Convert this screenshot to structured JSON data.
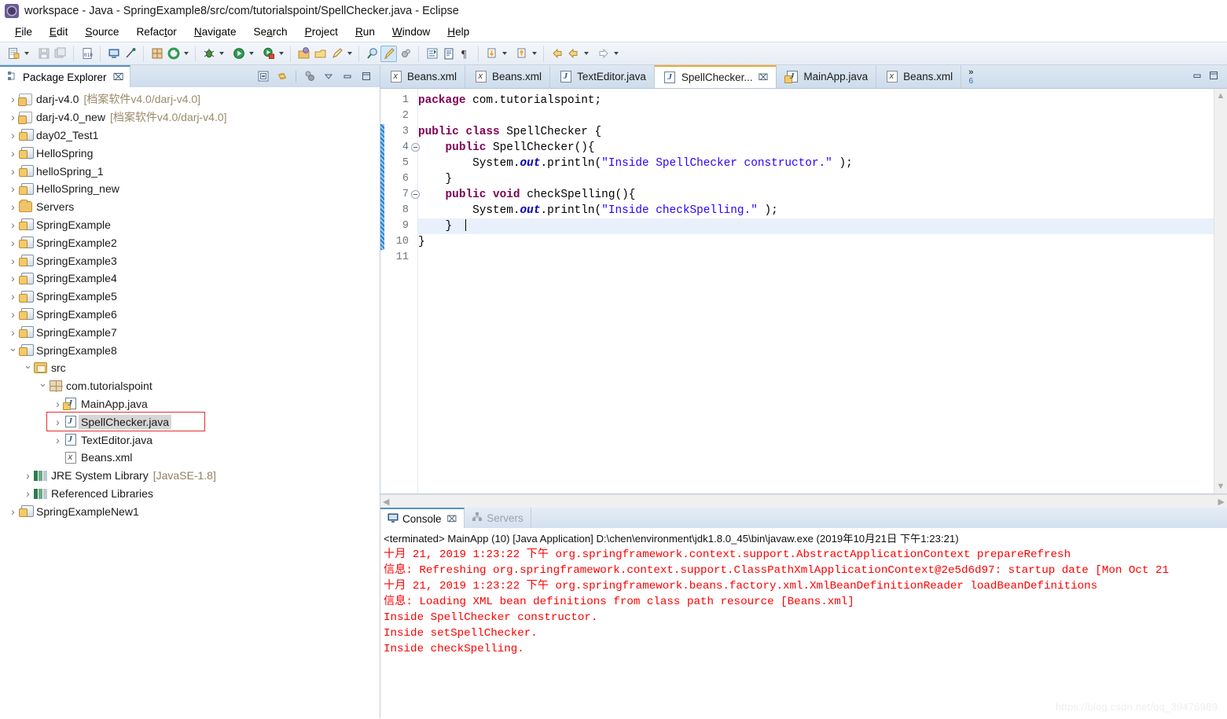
{
  "window": {
    "title": "workspace - Java - SpringExample8/src/com/tutorialspoint/SpellChecker.java - Eclipse",
    "app_icon": "eclipse-icon"
  },
  "menubar": [
    {
      "label": "File",
      "mnemonic": "F"
    },
    {
      "label": "Edit",
      "mnemonic": "E"
    },
    {
      "label": "Source",
      "mnemonic": "S"
    },
    {
      "label": "Refactor",
      "mnemonic": "t"
    },
    {
      "label": "Navigate",
      "mnemonic": "N"
    },
    {
      "label": "Search",
      "mnemonic": "a"
    },
    {
      "label": "Project",
      "mnemonic": "P"
    },
    {
      "label": "Run",
      "mnemonic": "R"
    },
    {
      "label": "Window",
      "mnemonic": "W"
    },
    {
      "label": "Help",
      "mnemonic": "H"
    }
  ],
  "toolbar": {
    "buttons": [
      "new-wizard-icon",
      "save-icon",
      "save-all-icon",
      "print-icon",
      "new-java-class-icon",
      "open-type-icon",
      "link-icon",
      "toggle-mark-occurrences-icon",
      "refresh-icon",
      "debug-icon",
      "run-icon",
      "run-external-tools-icon",
      "open-perspective-icon",
      "open-task-icon",
      "search-icon",
      "new-java-project-icon",
      "highlight-icon",
      "skip-breakpoints-icon",
      "next-annotation-icon",
      "previous-annotation-icon",
      "toggle-block-icon",
      "back-icon",
      "forward-icon"
    ]
  },
  "explorer": {
    "tab_label": "Package Explorer",
    "close_label": "⌧",
    "tools": [
      "collapse-all-icon",
      "link-with-editor-icon",
      "view-menu-icon",
      "minimize-icon",
      "maximize-icon"
    ],
    "tree": [
      {
        "label": "darj-v4.0",
        "note": "[档案软件v4.0/darj-v4.0]",
        "icon": "project-icon",
        "indent": 0,
        "twisty": "closed"
      },
      {
        "label": "darj-v4.0_new",
        "note": "[档案软件v4.0/darj-v4.0]",
        "icon": "project-icon",
        "indent": 0,
        "twisty": "closed"
      },
      {
        "label": "day02_Test1",
        "note": "",
        "icon": "java-project-icon",
        "indent": 0,
        "twisty": "closed"
      },
      {
        "label": "HelloSpring",
        "note": "",
        "icon": "java-project-icon",
        "indent": 0,
        "twisty": "closed"
      },
      {
        "label": "helloSpring_1",
        "note": "",
        "icon": "java-project-icon",
        "indent": 0,
        "twisty": "closed"
      },
      {
        "label": "HelloSpring_new",
        "note": "",
        "icon": "java-project-icon",
        "indent": 0,
        "twisty": "closed"
      },
      {
        "label": "Servers",
        "note": "",
        "icon": "folder-icon",
        "indent": 0,
        "twisty": "closed"
      },
      {
        "label": "SpringExample",
        "note": "",
        "icon": "java-project-icon",
        "indent": 0,
        "twisty": "closed"
      },
      {
        "label": "SpringExample2",
        "note": "",
        "icon": "java-project-icon",
        "indent": 0,
        "twisty": "closed"
      },
      {
        "label": "SpringExample3",
        "note": "",
        "icon": "java-project-icon",
        "indent": 0,
        "twisty": "closed"
      },
      {
        "label": "SpringExample4",
        "note": "",
        "icon": "java-project-icon",
        "indent": 0,
        "twisty": "closed"
      },
      {
        "label": "SpringExample5",
        "note": "",
        "icon": "java-project-icon",
        "indent": 0,
        "twisty": "closed"
      },
      {
        "label": "SpringExample6",
        "note": "",
        "icon": "java-project-icon",
        "indent": 0,
        "twisty": "closed"
      },
      {
        "label": "SpringExample7",
        "note": "",
        "icon": "java-project-icon",
        "indent": 0,
        "twisty": "closed"
      },
      {
        "label": "SpringExample8",
        "note": "",
        "icon": "java-project-icon",
        "indent": 0,
        "twisty": "open"
      },
      {
        "label": "src",
        "note": "",
        "icon": "source-folder-icon",
        "indent": 1,
        "twisty": "open"
      },
      {
        "label": "com.tutorialspoint",
        "note": "",
        "icon": "package-icon",
        "indent": 2,
        "twisty": "open"
      },
      {
        "label": "MainApp.java",
        "note": "",
        "icon": "java-file-warn-icon",
        "indent": 3,
        "twisty": "closed"
      },
      {
        "label": "SpellChecker.java",
        "note": "",
        "icon": "java-file-icon",
        "indent": 3,
        "twisty": "closed",
        "selected": true,
        "annotated": true
      },
      {
        "label": "TextEditor.java",
        "note": "",
        "icon": "java-file-icon",
        "indent": 3,
        "twisty": "closed"
      },
      {
        "label": "Beans.xml",
        "note": "",
        "icon": "xml-file-icon",
        "indent": 3,
        "twisty": "none"
      },
      {
        "label": "JRE System Library",
        "note": "[JavaSE-1.8]",
        "icon": "library-icon",
        "indent": 1,
        "twisty": "closed"
      },
      {
        "label": "Referenced Libraries",
        "note": "",
        "icon": "library-icon",
        "indent": 1,
        "twisty": "closed"
      },
      {
        "label": "SpringExampleNew1",
        "note": "",
        "icon": "java-project-icon",
        "indent": 0,
        "twisty": "closed"
      }
    ]
  },
  "editor": {
    "tabs": [
      {
        "label": "Beans.xml",
        "icon": "xml-file-icon",
        "selected": false
      },
      {
        "label": "Beans.xml",
        "icon": "xml-file-icon",
        "selected": false
      },
      {
        "label": "TextEditor.java",
        "icon": "java-file-icon",
        "selected": false
      },
      {
        "label": "SpellChecker...",
        "icon": "java-file-icon",
        "selected": true,
        "close": "⌧"
      },
      {
        "label": "MainApp.java",
        "icon": "java-file-warn-icon",
        "selected": false
      },
      {
        "label": "Beans.xml",
        "icon": "xml-file-icon",
        "selected": false
      }
    ],
    "overflow": {
      "symbol": "»",
      "count": "6"
    },
    "tools": [
      "restore-icon",
      "maximize-icon"
    ],
    "line_numbers": [
      "1",
      "2",
      "3",
      "4",
      "5",
      "6",
      "7",
      "8",
      "9",
      "10",
      "11"
    ],
    "fold_lines": [
      4,
      7
    ],
    "current_line": 9,
    "changed_range": {
      "from": 3,
      "to": 10
    },
    "code_lines": [
      [
        {
          "t": "package ",
          "c": "kw"
        },
        {
          "t": "com.tutorialspoint;",
          "c": ""
        }
      ],
      [],
      [
        {
          "t": "public class ",
          "c": "kw"
        },
        {
          "t": "SpellChecker {",
          "c": ""
        }
      ],
      [
        {
          "t": "    public ",
          "c": "kw"
        },
        {
          "t": "SpellChecker(){",
          "c": ""
        }
      ],
      [
        {
          "t": "        System.",
          "c": ""
        },
        {
          "t": "out",
          "c": "fld"
        },
        {
          "t": ".println(",
          "c": ""
        },
        {
          "t": "\"Inside SpellChecker constructor.\"",
          "c": "str"
        },
        {
          "t": " );",
          "c": ""
        }
      ],
      [
        {
          "t": "    }",
          "c": ""
        }
      ],
      [
        {
          "t": "    public void ",
          "c": "kw"
        },
        {
          "t": "checkSpelling(){",
          "c": ""
        }
      ],
      [
        {
          "t": "        System.",
          "c": ""
        },
        {
          "t": "out",
          "c": "fld"
        },
        {
          "t": ".println(",
          "c": ""
        },
        {
          "t": "\"Inside checkSpelling.\"",
          "c": "str"
        },
        {
          "t": " );",
          "c": ""
        }
      ],
      [
        {
          "t": "    }  ",
          "c": ""
        },
        {
          "t": "",
          "c": "caret"
        }
      ],
      [
        {
          "t": "}",
          "c": ""
        }
      ],
      []
    ]
  },
  "console": {
    "tabs": [
      {
        "label": "Console",
        "icon": "console-icon",
        "selected": true,
        "close": "⌧"
      },
      {
        "label": "Servers",
        "icon": "servers-icon",
        "selected": false
      }
    ],
    "header": "<terminated> MainApp (10) [Java Application] D:\\chen\\environment\\jdk1.8.0_45\\bin\\javaw.exe (2019年10月21日 下午1:23:21)",
    "lines": [
      {
        "text": "十月 21, 2019 1:23:22 下午 org.springframework.context.support.AbstractApplicationContext prepareRefresh",
        "kind": "err"
      },
      {
        "text": "信息: Refreshing org.springframework.context.support.ClassPathXmlApplicationContext@2e5d6d97: startup date [Mon Oct 21 ",
        "kind": "err"
      },
      {
        "text": "十月 21, 2019 1:23:22 下午 org.springframework.beans.factory.xml.XmlBeanDefinitionReader loadBeanDefinitions",
        "kind": "err"
      },
      {
        "text": "信息: Loading XML bean definitions from class path resource [Beans.xml]",
        "kind": "err"
      },
      {
        "text": "Inside SpellChecker constructor.",
        "kind": "out"
      },
      {
        "text": "Inside setSpellChecker.",
        "kind": "out"
      },
      {
        "text": "Inside checkSpelling.",
        "kind": "out"
      }
    ]
  },
  "watermark": "https://blog.csdn.net/qq_39476989",
  "colors": {
    "keyword": "#7f0055",
    "string": "#2a00ff",
    "field": "#0000c0",
    "console_error": "#ff0000",
    "annotation_box": "#e03030",
    "selection": "#d6d6d6",
    "current_line": "#e8f1fb",
    "tab_active_top": "#f0a830"
  }
}
